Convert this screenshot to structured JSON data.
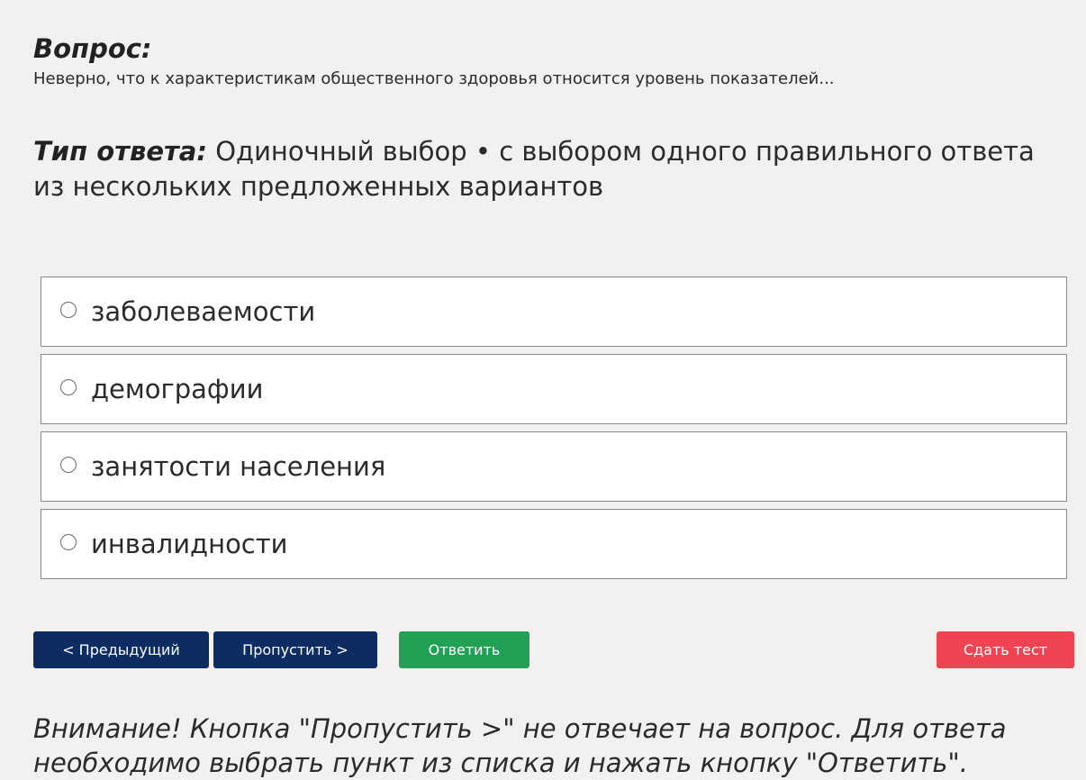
{
  "question": {
    "heading": "Вопрос:",
    "text": "Неверно, что к характеристикам общественного здоровья относится уровень показателей..."
  },
  "answer_type": {
    "label": "Тип ответа:",
    "value": "Одиночный выбор • с выбором одного правильного ответа из нескольких предложенных вариантов"
  },
  "options": [
    {
      "label": "заболеваемости",
      "selected": false
    },
    {
      "label": "демографии",
      "selected": false
    },
    {
      "label": "занятости населения",
      "selected": false
    },
    {
      "label": "инвалидности",
      "selected": false
    }
  ],
  "buttons": {
    "previous": "< Предыдущий",
    "skip": "Пропустить >",
    "answer": "Ответить",
    "submit": "Сдать тест"
  },
  "colors": {
    "nav_button": "#0d2d62",
    "answer_button": "#22a055",
    "submit_button": "#f04455",
    "background": "#f2f1ef"
  },
  "notice": "Внимание! Кнопка \"Пропустить >\" не отвечает на вопрос. Для ответа необходимо выбрать пункт из списка и нажать кнопку \"Ответить\"."
}
